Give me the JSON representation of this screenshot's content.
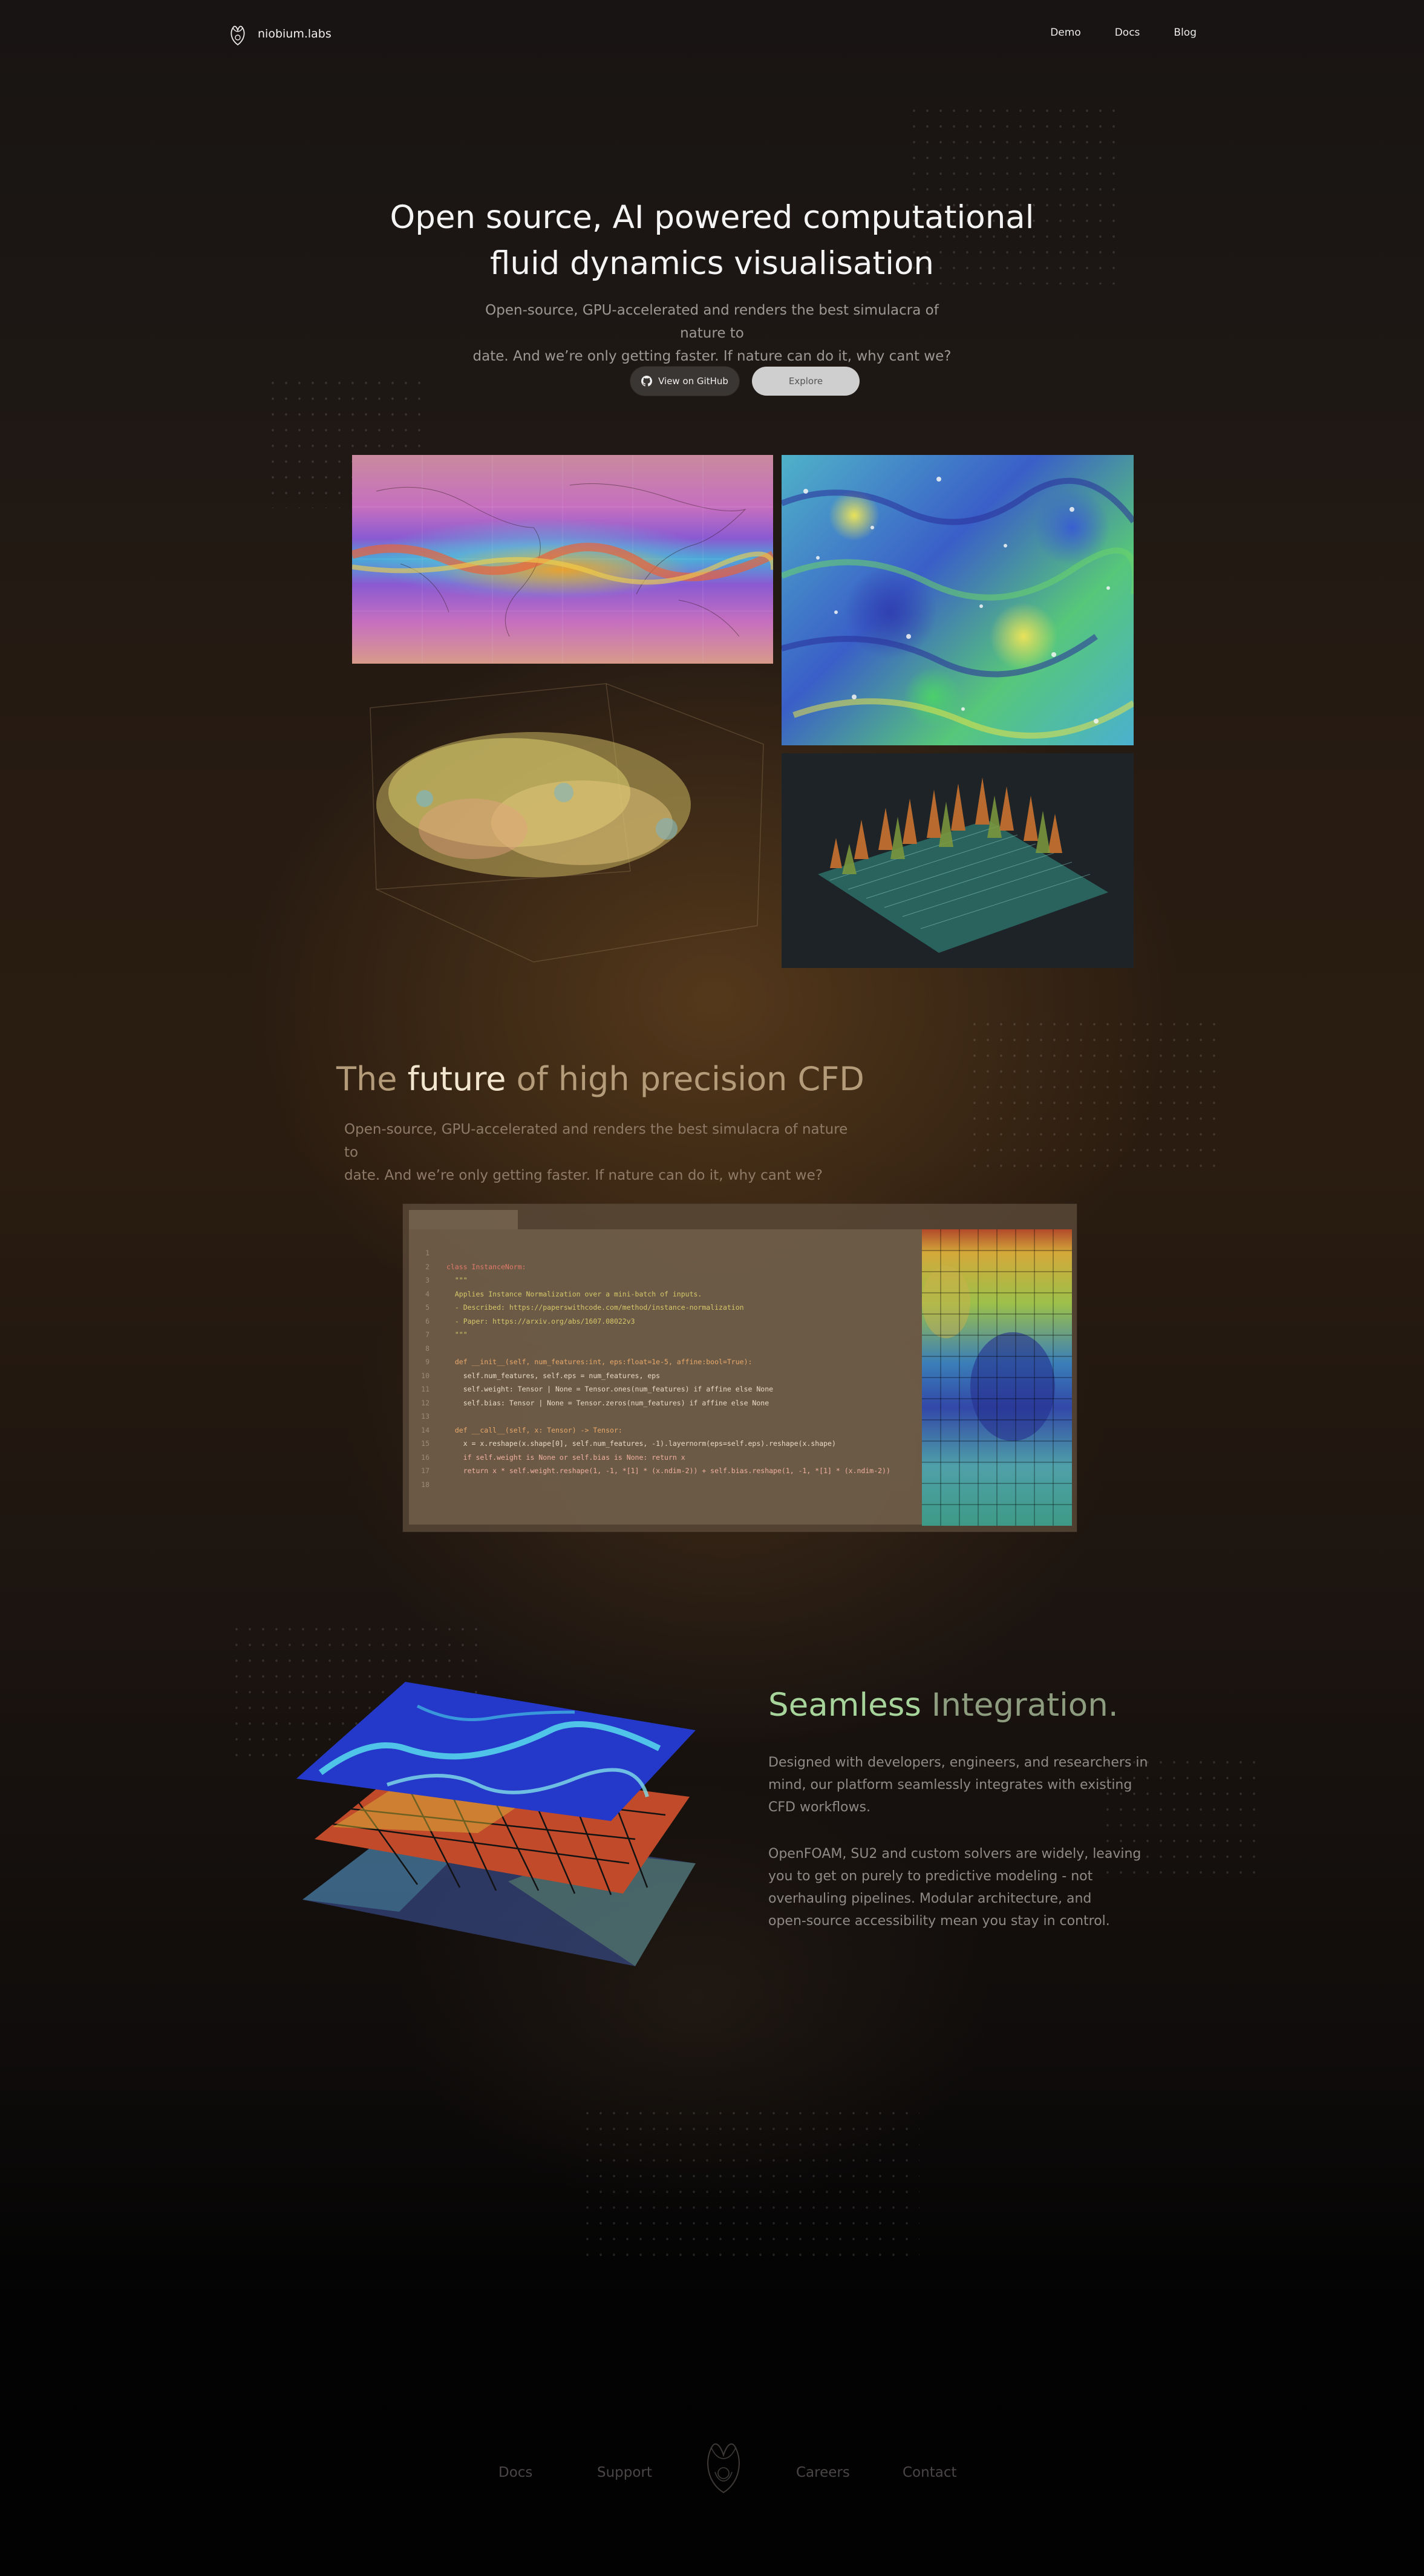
{
  "nav": {
    "brand": "niobium.labs",
    "links": [
      "Demo",
      "Docs",
      "Blog"
    ]
  },
  "hero": {
    "title_line1": "Open source, AI powered computational",
    "title_line2": "fluid dynamics visualisation",
    "subtitle_line1": "Open-source, GPU-accelerated and renders the best simulacra of nature to",
    "subtitle_line2": "date. And we’re only getting faster. If nature can do it, why cant we?",
    "github_button": "View on GitHub",
    "explore_button": "Explore"
  },
  "future": {
    "title_pre": "The",
    "title_highlight": "future",
    "title_post": "of high precision CFD",
    "subtitle_line1": "Open-source, GPU-accelerated and renders the best simulacra of nature to",
    "subtitle_line2": "date. And we’re only getting faster. If nature can do it, why cant we?"
  },
  "code": {
    "lines": [
      {
        "n": "1",
        "t": ""
      },
      {
        "n": "2",
        "t": "class InstanceNorm:"
      },
      {
        "n": "3",
        "t": "  \"\"\""
      },
      {
        "n": "4",
        "t": "  Applies Instance Normalization over a mini-batch of inputs."
      },
      {
        "n": "5",
        "t": "  - Described: https://paperswithcode.com/method/instance-normalization"
      },
      {
        "n": "6",
        "t": "  - Paper: https://arxiv.org/abs/1607.08022v3"
      },
      {
        "n": "7",
        "t": "  \"\"\""
      },
      {
        "n": "8",
        "t": ""
      },
      {
        "n": "9",
        "t": "  def __init__(self, num_features:int, eps:float=1e-5, affine:bool=True):"
      },
      {
        "n": "10",
        "t": "    self.num_features, self.eps = num_features, eps"
      },
      {
        "n": "11",
        "t": "    self.weight: Tensor | None = Tensor.ones(num_features) if affine else None"
      },
      {
        "n": "12",
        "t": "    self.bias: Tensor | None = Tensor.zeros(num_features) if affine else None"
      },
      {
        "n": "13",
        "t": ""
      },
      {
        "n": "14",
        "t": "  def __call__(self, x: Tensor) -> Tensor:"
      },
      {
        "n": "15",
        "t": "    x = x.reshape(x.shape[0], self.num_features, -1).layernorm(eps=self.eps).reshape(x.shape)"
      },
      {
        "n": "16",
        "t": "    if self.weight is None or self.bias is None: return x"
      },
      {
        "n": "17",
        "t": "    return x * self.weight.reshape(1, -1, *[1] * (x.ndim-2)) + self.bias.reshape(1, -1, *[1] * (x.ndim-2))"
      },
      {
        "n": "18",
        "t": ""
      }
    ]
  },
  "seamless": {
    "title_highlight": "Seamless",
    "title_rest": "Integration.",
    "para1_lines": [
      "Designed with developers, engineers, and researchers in",
      "mind, our platform seamlessly integrates with existing",
      "CFD workflows."
    ],
    "para2_lines": [
      "OpenFOAM, SU2 and custom solvers are widely, leaving",
      "you to get on purely to predictive modeling - not",
      "overhauling pipelines. Modular architecture, and",
      "open-source accessibility mean you stay in control."
    ]
  },
  "footer": {
    "links": [
      "Docs",
      "Support",
      "Careers",
      "Contact"
    ]
  },
  "colors": {
    "accent_seamless": "#a6d49b",
    "future_highlight": "#f3e6cf"
  },
  "icons": [
    "logo-icon",
    "github-icon"
  ]
}
